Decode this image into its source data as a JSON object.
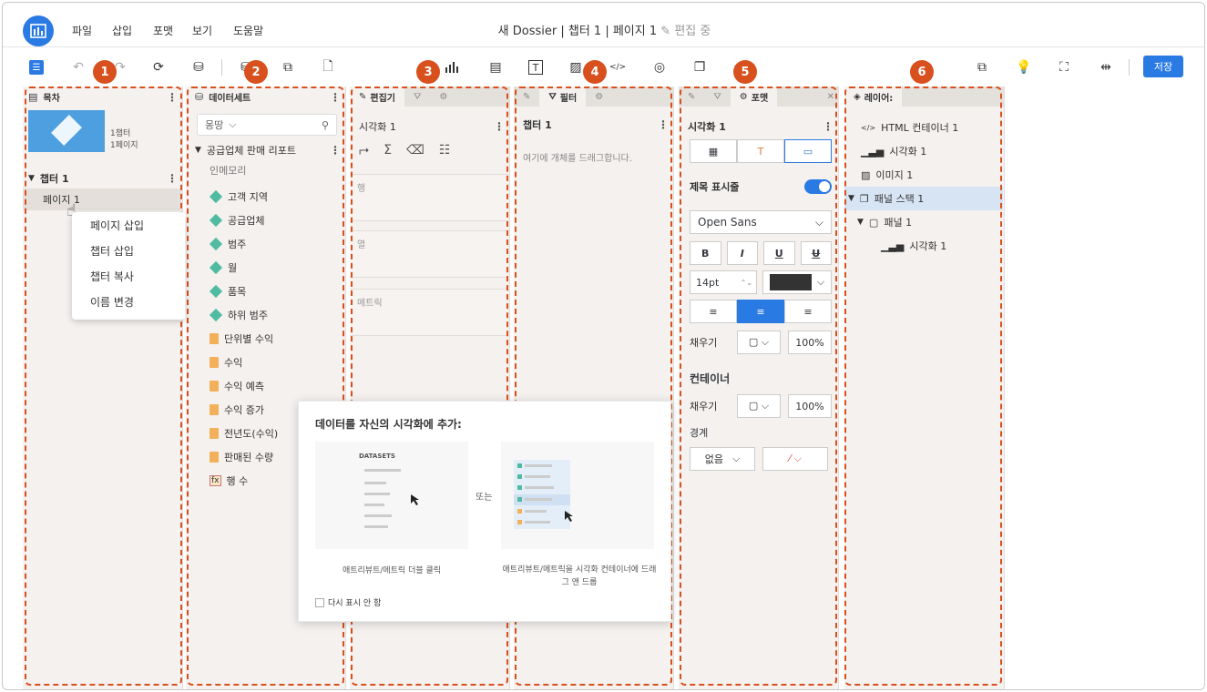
{
  "app": {
    "title": "새 Dossier | 챕터 1 | 페이지 1",
    "edit_state": "편집 중",
    "save_label": "저장",
    "menu": [
      "파일",
      "삽입",
      "포맷",
      "보기",
      "도움말"
    ],
    "accent": "#2a7ae3"
  },
  "badges": [
    "1",
    "2",
    "3",
    "4",
    "5",
    "6"
  ],
  "toc": {
    "header": "목차",
    "thumb_line1": "1챕터",
    "thumb_line2": "1페이지",
    "chapter": "챕터 1",
    "page": "페이지 1",
    "context_menu": [
      "페이지 삽입",
      "챕터 삽입",
      "챕터 복사",
      "이름 변경"
    ]
  },
  "datasets": {
    "header": "데이터세트",
    "search_placeholder": "몽땅",
    "report": "공급업체 판매 리포트",
    "source": "인메모리",
    "attributes": [
      "고객 지역",
      "공급업체",
      "범주",
      "월",
      "품목",
      "하위 범주"
    ],
    "metrics": [
      "단위별 수익",
      "수익",
      "수익 예측",
      "수익 증가",
      "전년도(수익)",
      "판매된 수량"
    ],
    "row_count": "행 수"
  },
  "editor": {
    "tab_label": "편집기",
    "viz_title": "시각화 1",
    "zones": [
      "행",
      "열",
      "메트릭"
    ]
  },
  "filter": {
    "tab_label": "필터",
    "chapter": "챕터 1",
    "hint": "여기에 개체를 드래그합니다."
  },
  "format": {
    "tab_label": "포맷",
    "viz_title": "시각화 1",
    "title_bar_label": "제목 표시줄",
    "font": "Open Sans",
    "style_buttons": [
      "B",
      "I",
      "U",
      "U"
    ],
    "font_size": "14pt",
    "fill_label": "채우기",
    "fill_opacity": "100%",
    "container_label": "컨테이너",
    "container_fill_label": "채우기",
    "container_opacity": "100%",
    "border_label": "경계",
    "border_value": "없음"
  },
  "layers": {
    "tab_label": "레이어:",
    "items": [
      "HTML 컨테이너 1",
      "시각화 1",
      "이미지 1",
      "패널 스택 1",
      "패널 1",
      "시각화 1"
    ]
  },
  "popup": {
    "title": "데이터를 자신의 시각화에 추가:",
    "datasets_label": "DATASETS",
    "or_label": "또는",
    "caption_left": "애트리뷰트/메트릭 더블 클릭",
    "caption_right": "애트리뷰트/메트릭을 시각화 컨테이너에 드래그 앤 드롭",
    "dont_show": "다시 표시 안 함"
  }
}
